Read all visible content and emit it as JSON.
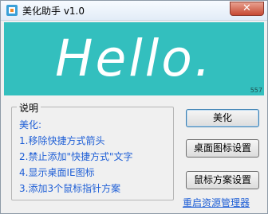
{
  "window": {
    "title": "美化助手 v1.0"
  },
  "banner": {
    "text": "Hello.",
    "build": "557",
    "color": "#33bfbe"
  },
  "description": {
    "title": "说明",
    "lines": [
      "美化:",
      "1.移除快捷方式箭头",
      "2.禁止添加\"快捷方式\"文字",
      "4.显示桌面IE图标",
      "3.添加3个鼠标指针方案"
    ]
  },
  "buttons": {
    "beautify": "美化",
    "desktop_icons": "桌面图标设置",
    "cursor_scheme": "鼠标方案设置"
  },
  "link": {
    "restart_explorer": "重启资源管理器"
  },
  "icons": {
    "app": "app-icon",
    "close": "close-icon"
  }
}
